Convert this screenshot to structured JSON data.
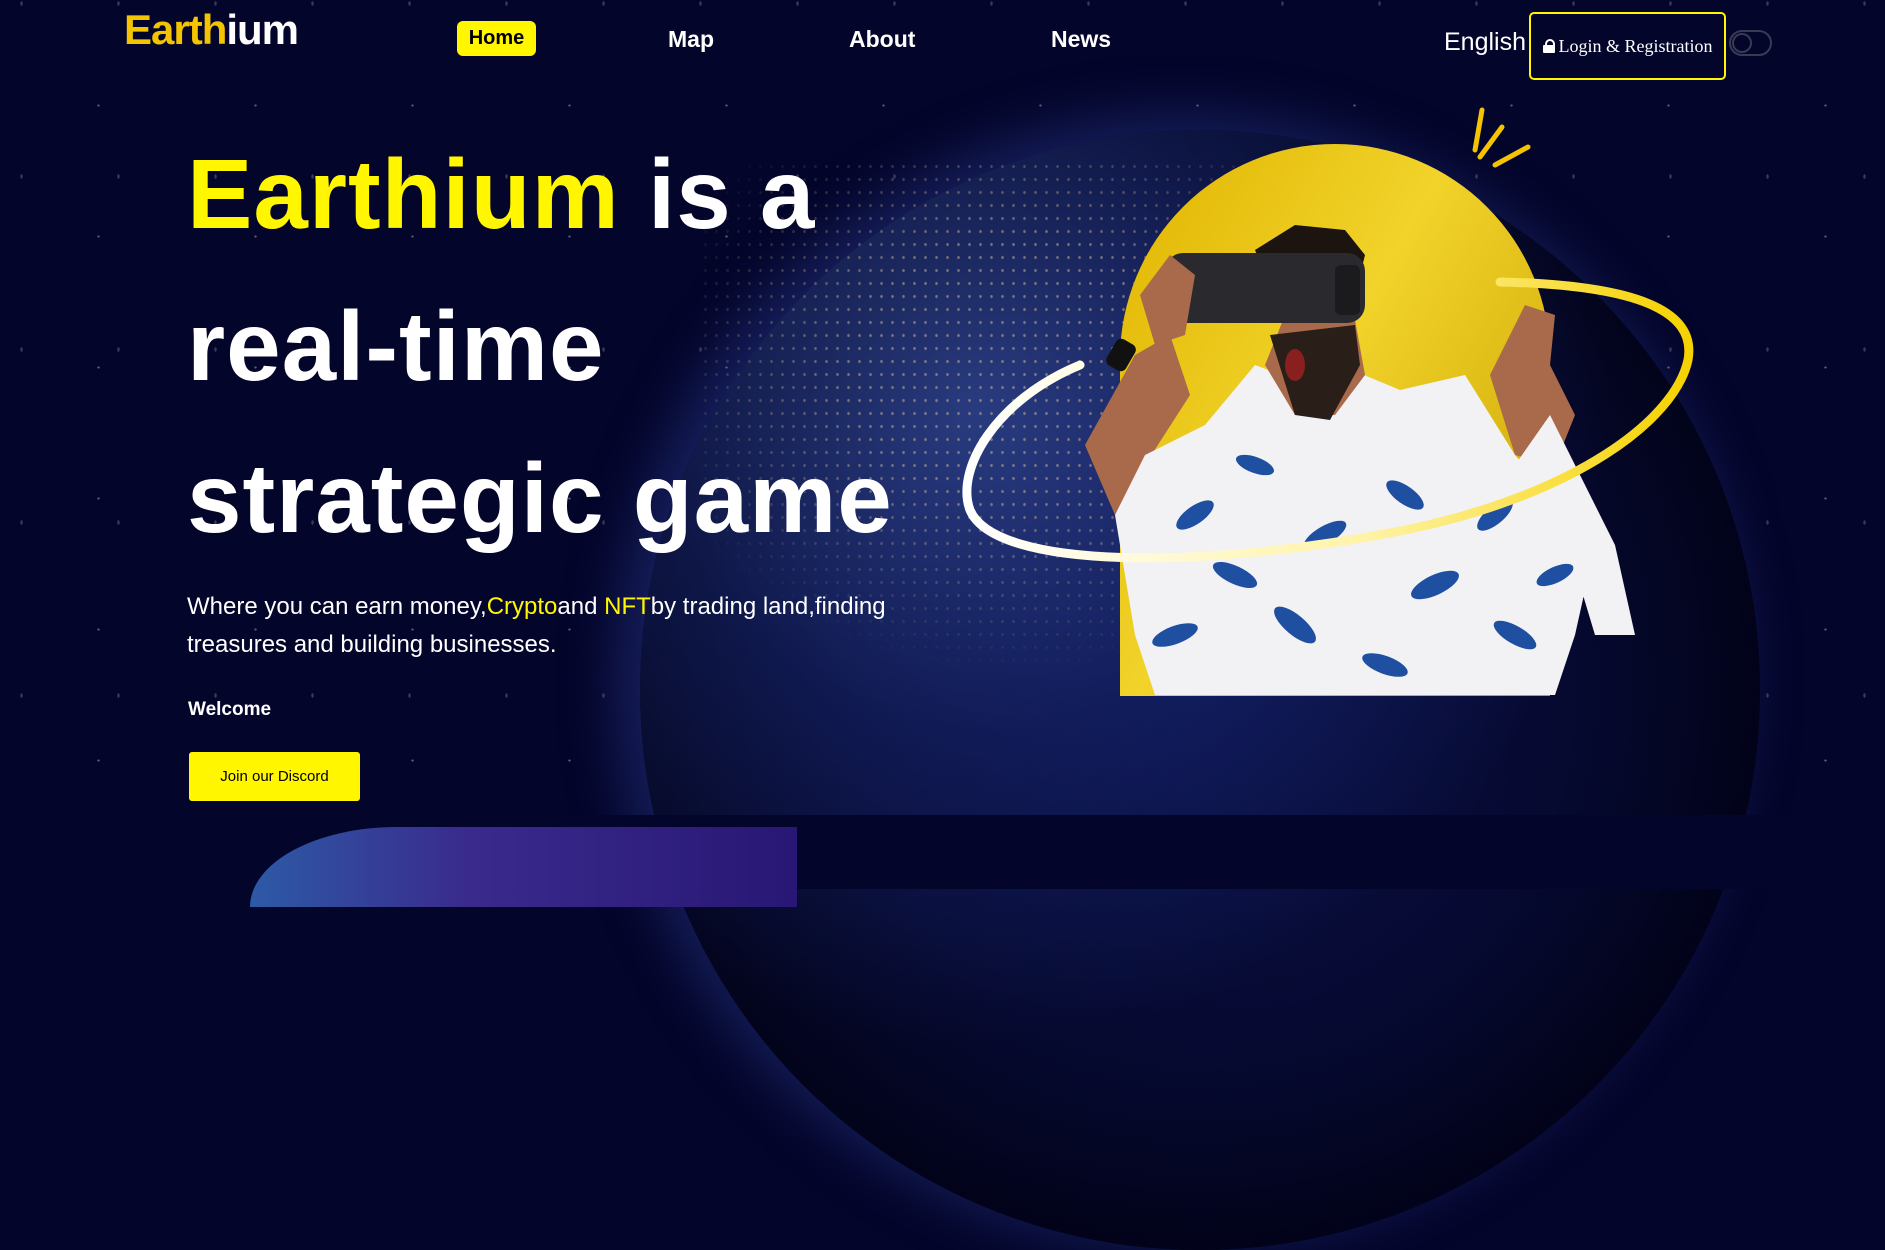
{
  "nav": {
    "logo_part1": "Earth",
    "logo_part2": "ium",
    "items": [
      {
        "label": "Home"
      },
      {
        "label": "Map"
      },
      {
        "label": "About"
      },
      {
        "label": "News"
      }
    ],
    "language": "English",
    "login_label": "Login & Registration"
  },
  "hero": {
    "title_highlight": "Earthium",
    "title_line1_rest": " is a",
    "title_line2": "real-time",
    "title_line3": "strategic game",
    "desc_part1": "Where you can earn money,",
    "desc_crypto": "Crypto",
    "desc_and": "and ",
    "desc_nft": "NFT",
    "desc_part2": "by trading land,finding treasures and building businesses.",
    "welcome": "Welcome",
    "cta": "Join our Discord"
  },
  "colors": {
    "accent": "#fff600",
    "logo_yellow": "#f5c400",
    "background": "#04052a"
  }
}
